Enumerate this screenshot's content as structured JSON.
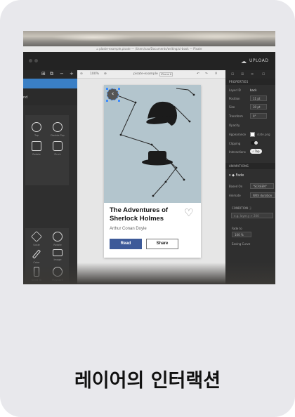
{
  "caption": "레이어의 인터랙션",
  "window": {
    "title": "⌂ plaste-example.pisate — /Users/sau/Documents/writing/ui-book — Pixate",
    "upload_label": "UPLOAD",
    "upload_icon": "cloud-icon"
  },
  "left_panel": {
    "toolbar": [
      "⊞",
      "⧉",
      "−",
      "+"
    ],
    "layer_label": "nd",
    "actions_top": [
      {
        "label": "Tap",
        "icon": "tap-icon"
      },
      {
        "label": "Double Tap",
        "icon": "double-tap-icon"
      },
      {
        "label": "Rotate",
        "icon": "rotate-icon"
      },
      {
        "label": "Pinch",
        "icon": "pinch-icon"
      }
    ],
    "actions_bottom": [
      {
        "label": "Scale",
        "icon": "scale-icon"
      },
      {
        "label": "Rotate",
        "icon": "rotate-icon"
      },
      {
        "label": "Color",
        "icon": "color-icon"
      },
      {
        "label": "Image",
        "icon": "image-icon"
      },
      {
        "label": "Scroll To",
        "icon": "scroll-to-icon"
      },
      {
        "label": "Playback",
        "icon": "playback-icon"
      }
    ]
  },
  "canvas_toolbar": {
    "zoom": "100%",
    "doc_name": "pisate-example",
    "device": "iPhone 6"
  },
  "book": {
    "title_line1": "The Adventures of",
    "title_line2": "Sherlock Holmes",
    "author": "Arthur Conan Doyle",
    "read_label": "Read",
    "share_label": "Share",
    "art_color": "#b3c5cd",
    "read_color": "#3d5a99"
  },
  "properties": {
    "section_label": "PROPERTIES",
    "rows": [
      {
        "label": "Layer ID",
        "value": "back"
      },
      {
        "label": "Position",
        "value": "11 pt"
      },
      {
        "label": "Size",
        "value": "30 pt"
      },
      {
        "label": "Transform",
        "value": "0°"
      },
      {
        "label": "Opacity",
        "value": ""
      },
      {
        "label": "Appearance",
        "value": "slate.png"
      },
      {
        "label": "Clipping",
        "value": ""
      },
      {
        "label": "Interactions",
        "value": "Tap"
      }
    ]
  },
  "animations": {
    "section_label": "ANIMATIONS",
    "name": "Fade",
    "based_on_label": "Based On",
    "based_on_value": "\"SCREEN\"",
    "animate_label": "Animate",
    "animate_value": "With duration",
    "condition_label": "CONDITION",
    "condition_placeholder": "e.g. layer.y > 200",
    "fade_to_label": "Fade to",
    "fade_to_value": "100 %",
    "easing_label": "Easing Curve"
  }
}
